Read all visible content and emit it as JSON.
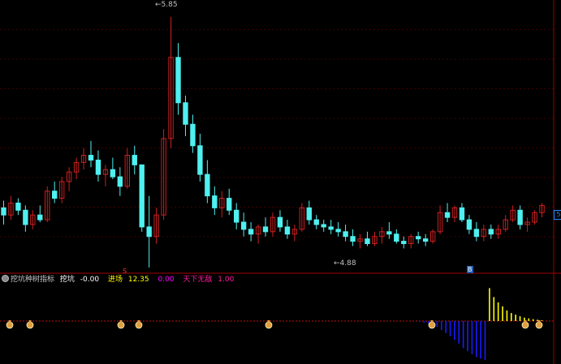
{
  "chart_data": {
    "type": "candlestick",
    "price_panel": {
      "high_label": "5.85",
      "low_label": "4.88",
      "right_axis_tag": "5",
      "markers": {
        "sell": "S",
        "buy": "B"
      },
      "candles": [
        [
          5.05,
          5.08,
          4.98,
          5.02
        ],
        [
          5.02,
          5.1,
          5.0,
          5.07
        ],
        [
          5.07,
          5.09,
          5.02,
          5.04
        ],
        [
          5.04,
          5.06,
          4.95,
          4.98
        ],
        [
          4.98,
          5.04,
          4.96,
          5.02
        ],
        [
          5.02,
          5.06,
          4.99,
          5.0
        ],
        [
          5.0,
          5.14,
          4.99,
          5.12
        ],
        [
          5.12,
          5.16,
          5.07,
          5.09
        ],
        [
          5.09,
          5.18,
          5.07,
          5.16
        ],
        [
          5.16,
          5.22,
          5.12,
          5.2
        ],
        [
          5.2,
          5.26,
          5.17,
          5.24
        ],
        [
          5.24,
          5.3,
          5.21,
          5.27
        ],
        [
          5.27,
          5.33,
          5.22,
          5.25
        ],
        [
          5.25,
          5.29,
          5.16,
          5.19
        ],
        [
          5.19,
          5.23,
          5.14,
          5.21
        ],
        [
          5.21,
          5.26,
          5.17,
          5.18
        ],
        [
          5.18,
          5.22,
          5.1,
          5.14
        ],
        [
          5.14,
          5.3,
          5.13,
          5.27
        ],
        [
          5.27,
          5.31,
          5.19,
          5.23
        ],
        [
          5.23,
          5.23,
          4.95,
          4.97
        ],
        [
          4.97,
          5.1,
          4.8,
          4.93
        ],
        [
          4.93,
          5.05,
          4.9,
          5.02
        ],
        [
          5.02,
          5.38,
          5.0,
          5.34
        ],
        [
          5.34,
          5.85,
          5.3,
          5.68
        ],
        [
          5.68,
          5.74,
          5.44,
          5.49
        ],
        [
          5.49,
          5.52,
          5.35,
          5.4
        ],
        [
          5.4,
          5.44,
          5.28,
          5.31
        ],
        [
          5.31,
          5.36,
          5.16,
          5.19
        ],
        [
          5.19,
          5.25,
          5.07,
          5.1
        ],
        [
          5.1,
          5.14,
          5.02,
          5.05
        ],
        [
          5.05,
          5.12,
          5.01,
          5.09
        ],
        [
          5.09,
          5.13,
          5.02,
          5.04
        ],
        [
          5.04,
          5.07,
          4.96,
          4.99
        ],
        [
          4.99,
          5.03,
          4.93,
          4.96
        ],
        [
          4.96,
          4.99,
          4.91,
          4.94
        ],
        [
          4.94,
          4.98,
          4.9,
          4.97
        ],
        [
          4.97,
          5.01,
          4.93,
          4.95
        ],
        [
          4.95,
          5.03,
          4.93,
          5.01
        ],
        [
          5.01,
          5.04,
          4.95,
          4.97
        ],
        [
          4.97,
          5.0,
          4.92,
          4.94
        ],
        [
          4.94,
          4.98,
          4.91,
          4.96
        ],
        [
          4.96,
          5.07,
          4.95,
          5.05
        ],
        [
          5.05,
          5.08,
          4.98,
          5.0
        ],
        [
          5.0,
          5.02,
          4.96,
          4.98
        ],
        [
          4.98,
          5.0,
          4.95,
          4.97
        ],
        [
          4.97,
          5.0,
          4.94,
          4.96
        ],
        [
          4.96,
          4.99,
          4.93,
          4.95
        ],
        [
          4.95,
          4.98,
          4.91,
          4.93
        ],
        [
          4.93,
          4.96,
          4.89,
          4.91
        ],
        [
          4.91,
          4.94,
          4.88,
          4.92
        ],
        [
          4.92,
          4.95,
          4.89,
          4.9
        ],
        [
          4.9,
          4.95,
          4.89,
          4.93
        ],
        [
          4.93,
          4.97,
          4.9,
          4.95
        ],
        [
          4.95,
          4.99,
          4.92,
          4.94
        ],
        [
          4.94,
          4.96,
          4.9,
          4.91
        ],
        [
          4.91,
          4.93,
          4.88,
          4.9
        ],
        [
          4.9,
          4.94,
          4.88,
          4.93
        ],
        [
          4.93,
          4.95,
          4.9,
          4.92
        ],
        [
          4.92,
          4.94,
          4.89,
          4.91
        ],
        [
          4.91,
          4.96,
          4.9,
          4.95
        ],
        [
          4.95,
          5.06,
          4.94,
          5.03
        ],
        [
          5.03,
          5.07,
          4.99,
          5.01
        ],
        [
          5.01,
          5.06,
          4.99,
          5.05
        ],
        [
          5.05,
          5.07,
          4.99,
          5.0
        ],
        [
          5.0,
          5.02,
          4.94,
          4.96
        ],
        [
          4.96,
          4.99,
          4.91,
          4.93
        ],
        [
          4.93,
          4.98,
          4.91,
          4.96
        ],
        [
          4.96,
          4.98,
          4.92,
          4.94
        ],
        [
          4.94,
          4.98,
          4.92,
          4.96
        ],
        [
          4.96,
          5.02,
          4.95,
          5.0
        ],
        [
          5.0,
          5.06,
          4.99,
          5.04
        ],
        [
          5.04,
          5.06,
          4.96,
          4.98
        ],
        [
          4.98,
          5.01,
          4.95,
          4.99
        ],
        [
          4.99,
          5.04,
          4.98,
          5.03
        ],
        [
          5.03,
          5.07,
          5.01,
          5.06
        ]
      ],
      "ylim": [
        4.8,
        5.9
      ]
    },
    "indicator_panel": {
      "title": "挖坑种树指标",
      "legend": [
        {
          "label": "挖坑",
          "value": "-0.00",
          "color": "#ffffff"
        },
        {
          "label": "进场",
          "value": "12.35",
          "color": "#ffff00"
        },
        {
          "label": "",
          "value": "0.00",
          "color": "#ff00ff"
        },
        {
          "label": "天下无敌",
          "value": "1.00",
          "color": "#ff1a9a"
        }
      ],
      "bars": [
        0,
        0,
        0,
        0,
        0,
        0,
        0,
        0,
        0,
        0,
        0,
        0,
        0,
        0,
        0,
        0,
        0,
        0,
        0,
        0,
        0,
        0,
        0,
        0,
        0,
        0,
        0,
        0,
        0,
        0,
        0,
        0,
        0,
        0,
        0,
        0,
        0,
        0,
        0,
        0,
        0,
        0,
        0,
        0,
        0,
        0,
        -1,
        -2,
        -3,
        -5,
        -8,
        -12,
        -16,
        -20,
        -25,
        -30,
        -36,
        -40,
        -44,
        -48,
        -50,
        -52,
        12.35,
        9,
        7,
        5.5,
        4,
        3,
        2.4,
        1.8,
        1.3,
        1,
        0.7,
        0.5,
        0.3
      ],
      "ylim": [
        -55,
        14
      ],
      "flag_positions": [
        2,
        7,
        27,
        32,
        60,
        99,
        120,
        125
      ],
      "colors": {
        "positive": "#ffff00",
        "negative": "#1a1aff",
        "baseline": "#c01010"
      }
    },
    "colors": {
      "up": "#cc2020",
      "down": "#4ff0f0",
      "grid": "#7a0000",
      "divider": "#a00000"
    }
  }
}
